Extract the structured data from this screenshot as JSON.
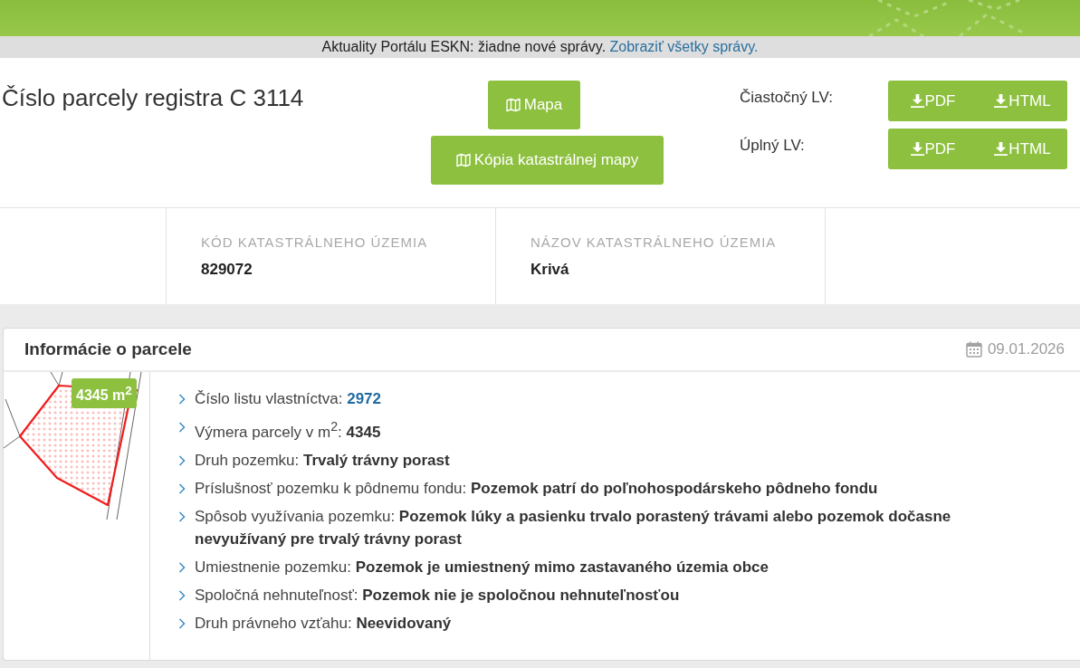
{
  "news_bar": {
    "text": "Aktuality Portálu ESKN: žiadne nové správy.",
    "link": "Zobraziť všetky správy."
  },
  "header": {
    "title": "Číslo parcely registra C 3114",
    "map_buttons": [
      "Mapa",
      "Kópia katastrálnej mapy"
    ],
    "lv_rows": [
      {
        "label": "Čiastočný LV:",
        "buttons": [
          "PDF",
          "HTML"
        ]
      },
      {
        "label": "Úplný LV:",
        "buttons": [
          "PDF",
          "HTML"
        ]
      }
    ]
  },
  "cadastral_area": [
    {
      "label": "KÓD KATASTRÁLNEHO ÚZEMIA",
      "value": "829072"
    },
    {
      "label": "NÁZOV KATASTRÁLNEHO ÚZEMIA",
      "value": "Krivá"
    }
  ],
  "parcel_info": {
    "title": "Informácie o parcele",
    "date": "09.01.2026",
    "area_label": "4345 m$^{2}$",
    "items": [
      {
        "label": "Číslo listu vlastníctva:",
        "value": "2972",
        "kind": "link"
      },
      {
        "label": "Výmera parcely v m$^{2}$:",
        "value": "4345",
        "kind": "text"
      },
      {
        "label": "Druh pozemku:",
        "value": "Trvalý trávny porast",
        "kind": "text"
      },
      {
        "label": "Príslušnosť pozemku k pôdnemu fondu:",
        "value": "Pozemok patrí do poľnohospodárskeho pôdneho fondu",
        "kind": "text"
      },
      {
        "label": "Spôsob využívania pozemku:",
        "value": "Pozemok lúky a pasienku trvalo porastený trávami alebo pozemok dočasne nevyužívaný pre trvalý trávny porast",
        "kind": "text"
      },
      {
        "label": "Umiestnenie pozemku:",
        "value": "Pozemok je umiestnený mimo zastavaného územia obce",
        "kind": "text"
      },
      {
        "label": "Spoločná nehnuteľnosť:",
        "value": "Pozemok nie je spoločnou nehnuteľnosťou",
        "kind": "text"
      },
      {
        "label": "Druh právneho vzťahu:",
        "value": "Neevidovaný",
        "kind": "text"
      }
    ]
  }
}
